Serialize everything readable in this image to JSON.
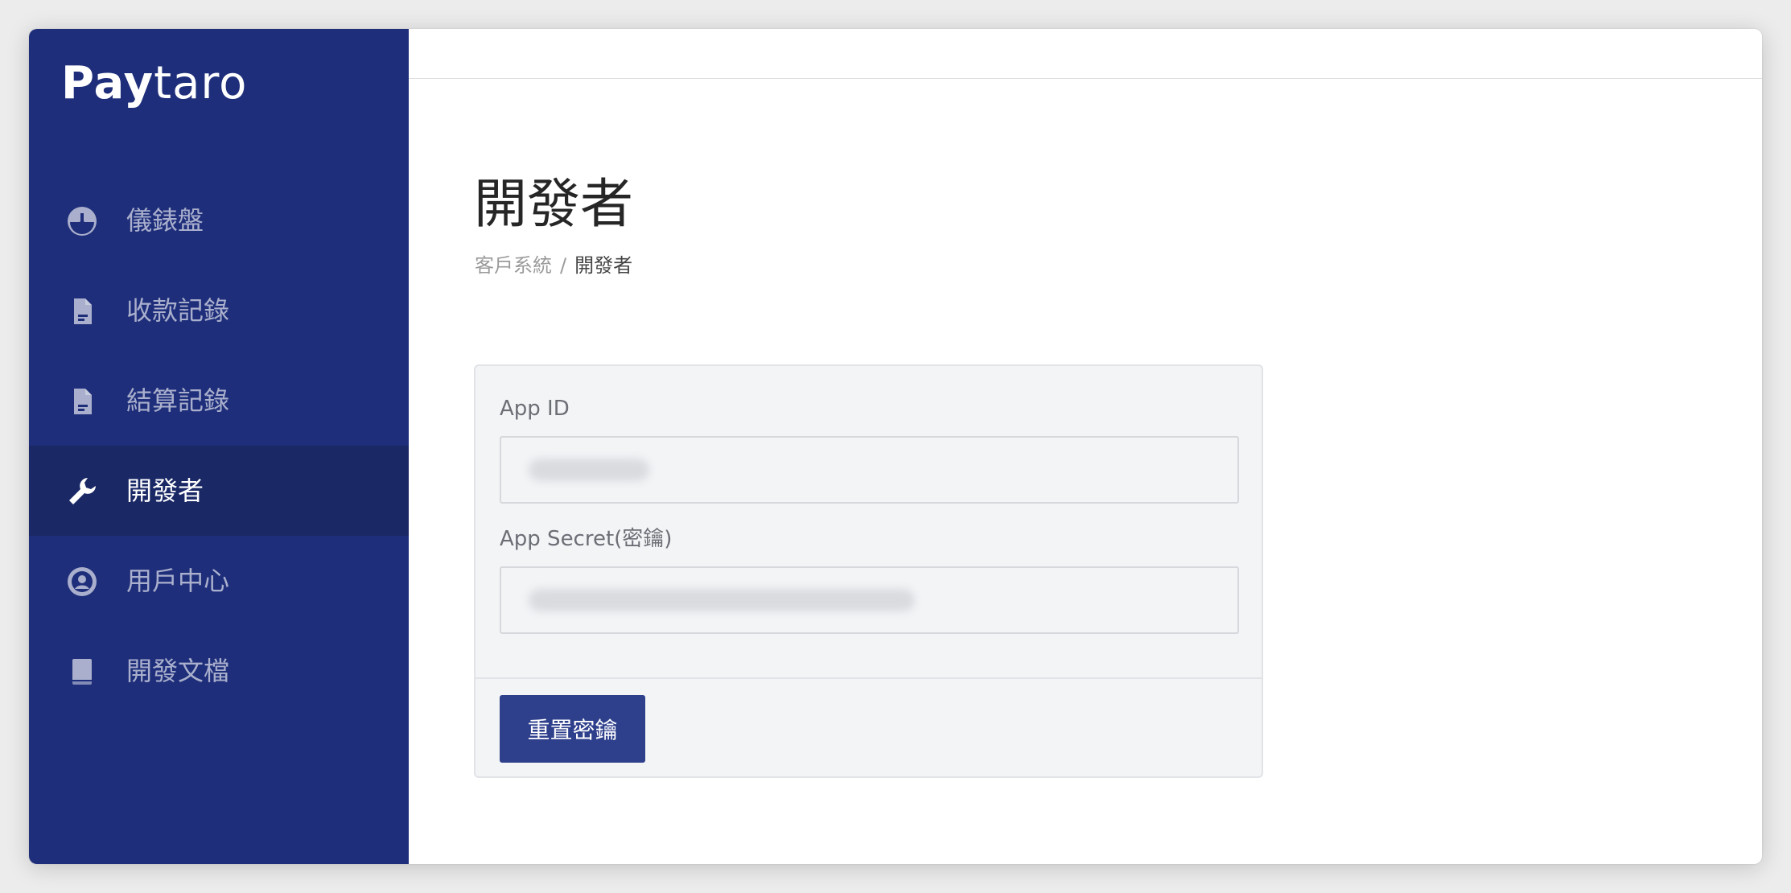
{
  "brand": {
    "logo_bold": "Pay",
    "logo_light": "taro"
  },
  "sidebar": {
    "items": [
      {
        "label": "儀錶盤",
        "icon": "dashboard-icon",
        "active": false
      },
      {
        "label": "收款記錄",
        "icon": "document-icon",
        "active": false
      },
      {
        "label": "結算記錄",
        "icon": "document-icon",
        "active": false
      },
      {
        "label": "開發者",
        "icon": "wrench-icon",
        "active": true
      },
      {
        "label": "用戶中心",
        "icon": "user-circle-icon",
        "active": false
      },
      {
        "label": "開發文檔",
        "icon": "book-icon",
        "active": false
      }
    ]
  },
  "main": {
    "title": "開發者",
    "breadcrumb": {
      "parent": "客戶系統",
      "separator": "/",
      "current": "開發者"
    },
    "form": {
      "app_id_label": "App ID",
      "app_id_value": "",
      "app_secret_label": "App Secret(密鑰)",
      "app_secret_value": "",
      "reset_button_label": "重置密鑰"
    }
  },
  "colors": {
    "sidebar_bg": "#1e2e7a",
    "sidebar_active_bg": "#1a2866",
    "button_bg": "#2e3f8c"
  }
}
